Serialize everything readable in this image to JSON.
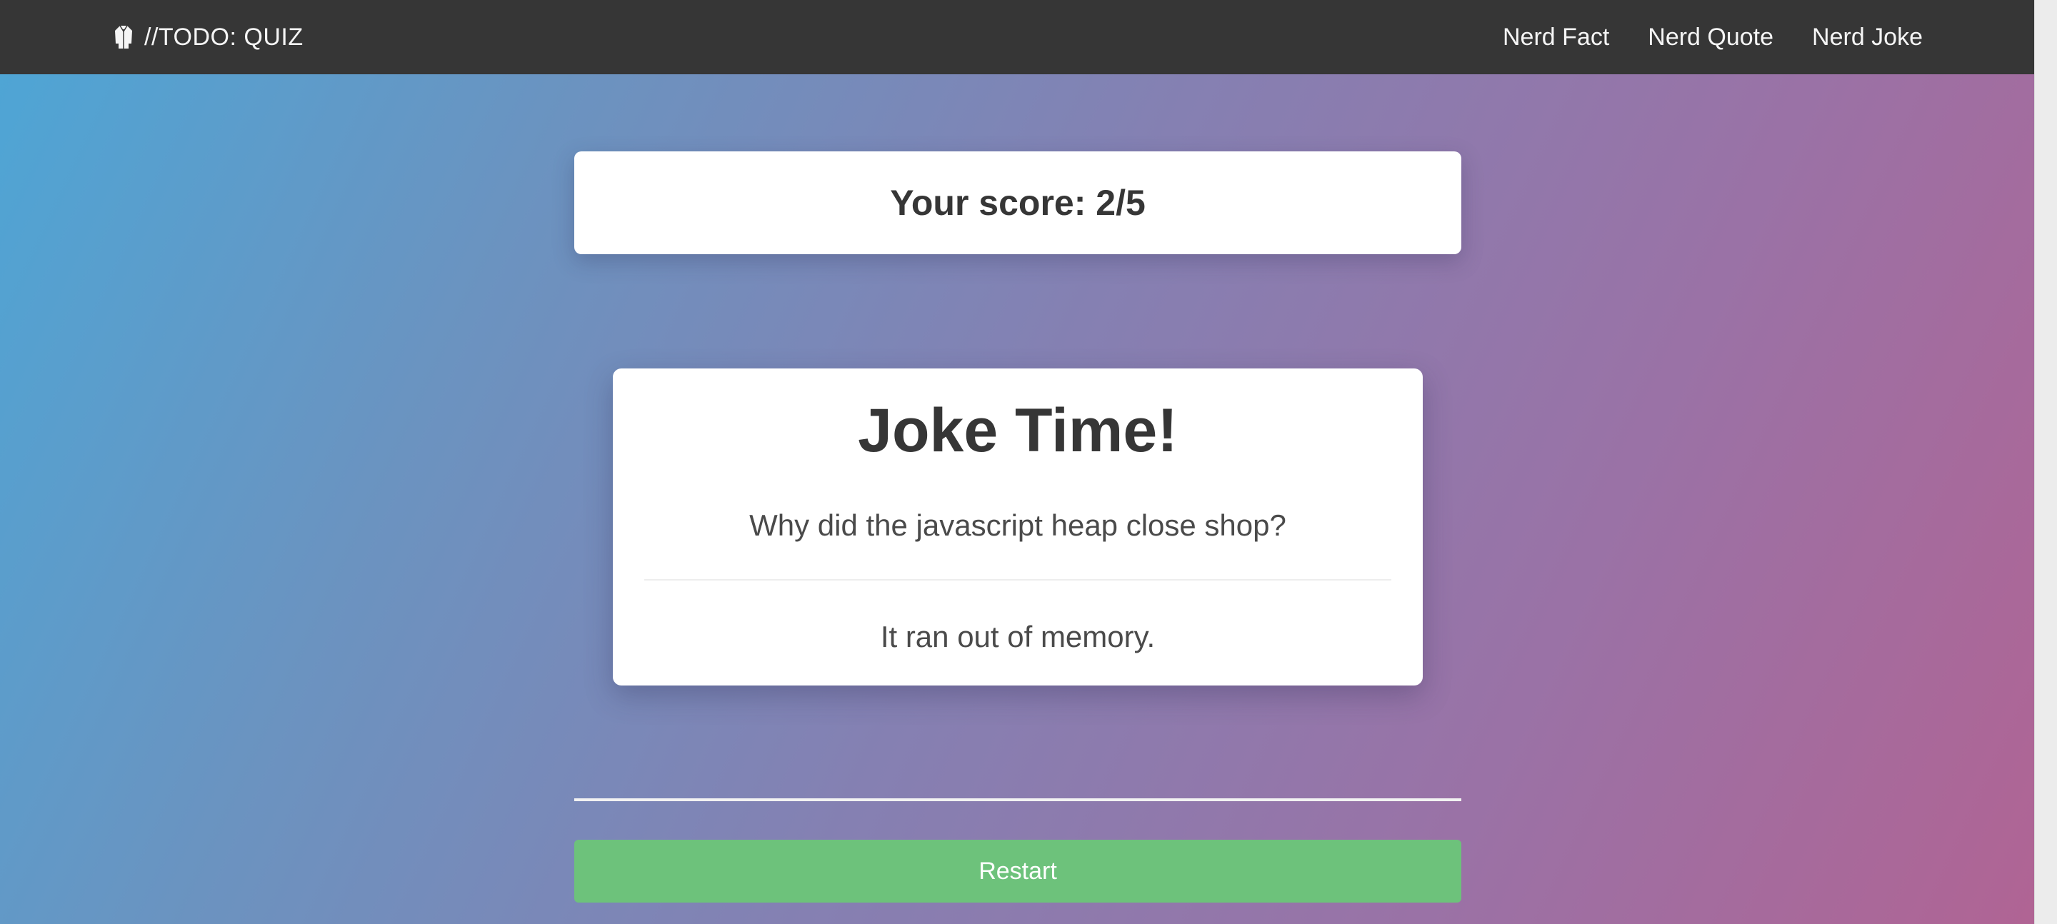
{
  "navbar": {
    "brand_icon": "lab-coat-icon",
    "brand_text": "//TODO: QUIZ",
    "links": [
      {
        "label": "Nerd Fact"
      },
      {
        "label": "Nerd Quote"
      },
      {
        "label": "Nerd Joke"
      }
    ]
  },
  "score": {
    "text": "Your score: 2/5"
  },
  "joke": {
    "title": "Joke Time!",
    "setup": "Why did the javascript heap close shop?",
    "punchline": "It ran out of memory."
  },
  "actions": {
    "restart_label": "Restart"
  },
  "colors": {
    "navbar": "#363636",
    "restart_button": "#6dc27b",
    "gradient_start": "#4da6d6",
    "gradient_end": "#b06494"
  }
}
